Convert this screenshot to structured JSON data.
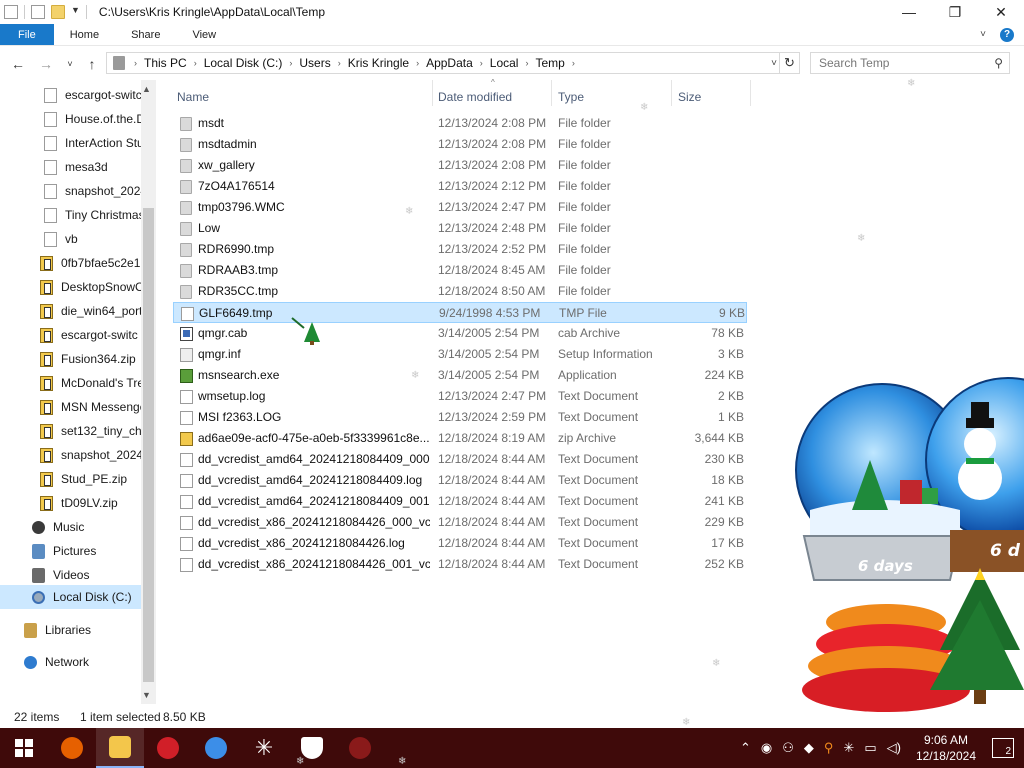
{
  "titlebar": {
    "path": "C:\\Users\\Kris Kringle\\AppData\\Local\\Temp",
    "min": "—",
    "max": "❐",
    "close": "✕"
  },
  "ribbon": {
    "tabs": [
      "File",
      "Home",
      "Share",
      "View"
    ]
  },
  "address": {
    "crumbs": [
      "This PC",
      "Local Disk (C:)",
      "Users",
      "Kris Kringle",
      "AppData",
      "Local",
      "Temp"
    ]
  },
  "search": {
    "placeholder": "Search Temp"
  },
  "sidebar": {
    "items": [
      {
        "label": "escargot-switc",
        "icon": "file"
      },
      {
        "label": "House.of.the.D",
        "icon": "file"
      },
      {
        "label": "InterAction Stu",
        "icon": "file"
      },
      {
        "label": "mesa3d",
        "icon": "file"
      },
      {
        "label": "snapshot_2024",
        "icon": "file"
      },
      {
        "label": "Tiny Christmas",
        "icon": "file"
      },
      {
        "label": "vb",
        "icon": "file"
      },
      {
        "label": "0fb7bfae5c2e1(",
        "icon": "zip"
      },
      {
        "label": "DesktopSnowC",
        "icon": "zip"
      },
      {
        "label": "die_win64_port",
        "icon": "zip"
      },
      {
        "label": "escargot-switc",
        "icon": "zip"
      },
      {
        "label": "Fusion364.zip",
        "icon": "zip"
      },
      {
        "label": "McDonald's Tre",
        "icon": "zip"
      },
      {
        "label": "MSN Messenge",
        "icon": "zip"
      },
      {
        "label": "set132_tiny_chr",
        "icon": "zip"
      },
      {
        "label": "snapshot_2024",
        "icon": "zip"
      },
      {
        "label": "Stud_PE.zip",
        "icon": "zip"
      },
      {
        "label": "tD09LV.zip",
        "icon": "zip"
      }
    ],
    "places": [
      {
        "label": "Music",
        "icon": "music"
      },
      {
        "label": "Pictures",
        "icon": "pics"
      },
      {
        "label": "Videos",
        "icon": "videos"
      },
      {
        "label": "Local Disk (C:)",
        "icon": "disk"
      }
    ],
    "libraries": "Libraries",
    "network": "Network"
  },
  "columns": {
    "name": "Name",
    "date": "Date modified",
    "type": "Type",
    "size": "Size"
  },
  "files": [
    {
      "name": "msdt",
      "date": "12/13/2024 2:08 PM",
      "type": "File folder",
      "size": "",
      "icon": "folder"
    },
    {
      "name": "msdtadmin",
      "date": "12/13/2024 2:08 PM",
      "type": "File folder",
      "size": "",
      "icon": "folder"
    },
    {
      "name": "xw_gallery",
      "date": "12/13/2024 2:08 PM",
      "type": "File folder",
      "size": "",
      "icon": "folder"
    },
    {
      "name": "7zO4A176514",
      "date": "12/13/2024 2:12 PM",
      "type": "File folder",
      "size": "",
      "icon": "folder"
    },
    {
      "name": "tmp03796.WMC",
      "date": "12/13/2024 2:47 PM",
      "type": "File folder",
      "size": "",
      "icon": "folder"
    },
    {
      "name": "Low",
      "date": "12/13/2024 2:48 PM",
      "type": "File folder",
      "size": "",
      "icon": "folder"
    },
    {
      "name": "RDR6990.tmp",
      "date": "12/13/2024 2:52 PM",
      "type": "File folder",
      "size": "",
      "icon": "folder"
    },
    {
      "name": "RDRAAB3.tmp",
      "date": "12/18/2024 8:45 AM",
      "type": "File folder",
      "size": "",
      "icon": "folder"
    },
    {
      "name": "RDR35CC.tmp",
      "date": "12/18/2024 8:50 AM",
      "type": "File folder",
      "size": "",
      "icon": "folder"
    },
    {
      "name": "GLF6649.tmp",
      "date": "9/24/1998 4:53 PM",
      "type": "TMP File",
      "size": "9 KB",
      "icon": "file",
      "selected": true
    },
    {
      "name": "qmgr.cab",
      "date": "3/14/2005 2:54 PM",
      "type": "cab Archive",
      "size": "78 KB",
      "icon": "cab"
    },
    {
      "name": "qmgr.inf",
      "date": "3/14/2005 2:54 PM",
      "type": "Setup Information",
      "size": "3 KB",
      "icon": "inf"
    },
    {
      "name": "msnsearch.exe",
      "date": "3/14/2005 2:54 PM",
      "type": "Application",
      "size": "224 KB",
      "icon": "exe"
    },
    {
      "name": "wmsetup.log",
      "date": "12/13/2024 2:47 PM",
      "type": "Text Document",
      "size": "2 KB",
      "icon": "file"
    },
    {
      "name": "MSI f2363.LOG",
      "date": "12/13/2024 2:59 PM",
      "type": "Text Document",
      "size": "1 KB",
      "icon": "file"
    },
    {
      "name": "ad6ae09e-acf0-475e-a0eb-5f3339961c8e....",
      "date": "12/18/2024 8:19 AM",
      "type": "zip Archive",
      "size": "3,644 KB",
      "icon": "zip"
    },
    {
      "name": "dd_vcredist_amd64_20241218084409_000...",
      "date": "12/18/2024 8:44 AM",
      "type": "Text Document",
      "size": "230 KB",
      "icon": "file"
    },
    {
      "name": "dd_vcredist_amd64_20241218084409.log",
      "date": "12/18/2024 8:44 AM",
      "type": "Text Document",
      "size": "18 KB",
      "icon": "file"
    },
    {
      "name": "dd_vcredist_amd64_20241218084409_001...",
      "date": "12/18/2024 8:44 AM",
      "type": "Text Document",
      "size": "241 KB",
      "icon": "file"
    },
    {
      "name": "dd_vcredist_x86_20241218084426_000_vc...",
      "date": "12/18/2024 8:44 AM",
      "type": "Text Document",
      "size": "229 KB",
      "icon": "file"
    },
    {
      "name": "dd_vcredist_x86_20241218084426.log",
      "date": "12/18/2024 8:44 AM",
      "type": "Text Document",
      "size": "17 KB",
      "icon": "file"
    },
    {
      "name": "dd_vcredist_x86_20241218084426_001_vc...",
      "date": "12/18/2024 8:44 AM",
      "type": "Text Document",
      "size": "252 KB",
      "icon": "file"
    }
  ],
  "status": {
    "count": "22 items",
    "selected": "1 item selected",
    "size": "8.50 KB"
  },
  "decoration": {
    "badge1": "6 days",
    "badge2": "6 d"
  },
  "taskbar": {
    "time": "9:06 AM",
    "date": "12/18/2024",
    "notifications": "2"
  },
  "colors": {
    "accent": "#1979ca",
    "selection": "#cce8ff",
    "taskbar": "#3f0a0a"
  }
}
